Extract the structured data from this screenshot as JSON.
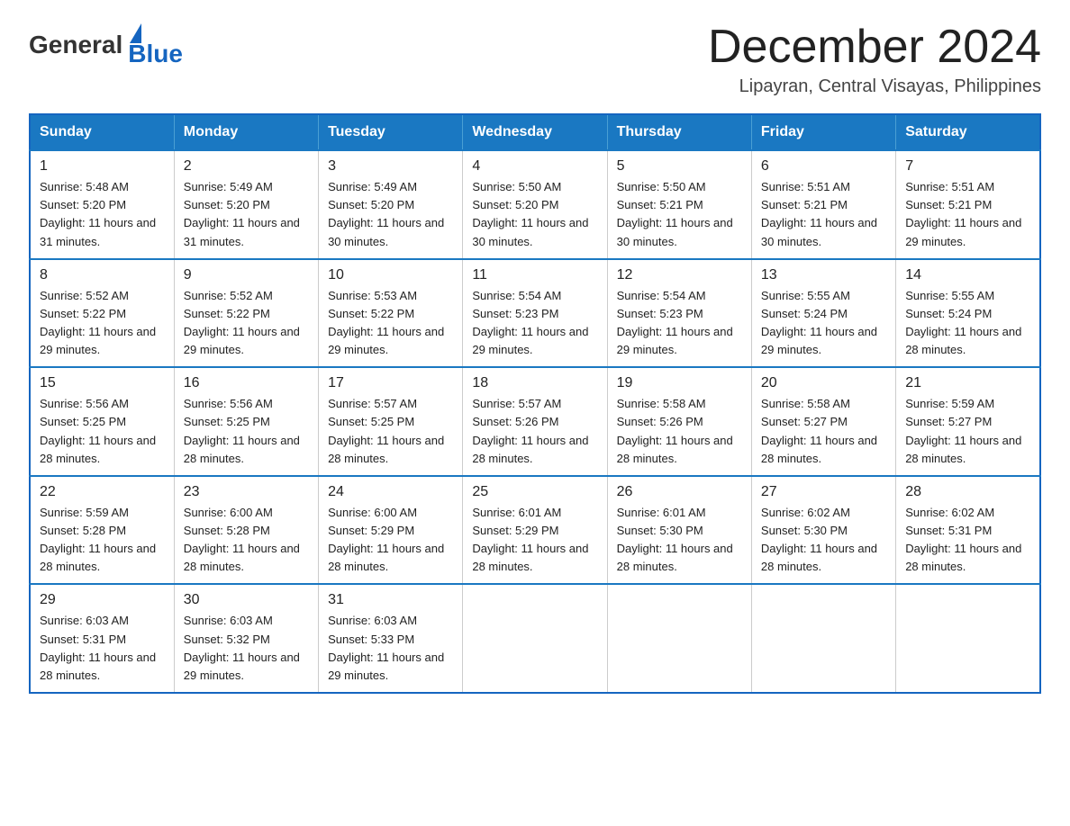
{
  "logo": {
    "general": "General",
    "blue": "Blue"
  },
  "header": {
    "title": "December 2024",
    "subtitle": "Lipayran, Central Visayas, Philippines"
  },
  "days_of_week": [
    "Sunday",
    "Monday",
    "Tuesday",
    "Wednesday",
    "Thursday",
    "Friday",
    "Saturday"
  ],
  "weeks": [
    [
      {
        "day": "1",
        "sunrise": "5:48 AM",
        "sunset": "5:20 PM",
        "daylight": "11 hours and 31 minutes."
      },
      {
        "day": "2",
        "sunrise": "5:49 AM",
        "sunset": "5:20 PM",
        "daylight": "11 hours and 31 minutes."
      },
      {
        "day": "3",
        "sunrise": "5:49 AM",
        "sunset": "5:20 PM",
        "daylight": "11 hours and 30 minutes."
      },
      {
        "day": "4",
        "sunrise": "5:50 AM",
        "sunset": "5:20 PM",
        "daylight": "11 hours and 30 minutes."
      },
      {
        "day": "5",
        "sunrise": "5:50 AM",
        "sunset": "5:21 PM",
        "daylight": "11 hours and 30 minutes."
      },
      {
        "day": "6",
        "sunrise": "5:51 AM",
        "sunset": "5:21 PM",
        "daylight": "11 hours and 30 minutes."
      },
      {
        "day": "7",
        "sunrise": "5:51 AM",
        "sunset": "5:21 PM",
        "daylight": "11 hours and 29 minutes."
      }
    ],
    [
      {
        "day": "8",
        "sunrise": "5:52 AM",
        "sunset": "5:22 PM",
        "daylight": "11 hours and 29 minutes."
      },
      {
        "day": "9",
        "sunrise": "5:52 AM",
        "sunset": "5:22 PM",
        "daylight": "11 hours and 29 minutes."
      },
      {
        "day": "10",
        "sunrise": "5:53 AM",
        "sunset": "5:22 PM",
        "daylight": "11 hours and 29 minutes."
      },
      {
        "day": "11",
        "sunrise": "5:54 AM",
        "sunset": "5:23 PM",
        "daylight": "11 hours and 29 minutes."
      },
      {
        "day": "12",
        "sunrise": "5:54 AM",
        "sunset": "5:23 PM",
        "daylight": "11 hours and 29 minutes."
      },
      {
        "day": "13",
        "sunrise": "5:55 AM",
        "sunset": "5:24 PM",
        "daylight": "11 hours and 29 minutes."
      },
      {
        "day": "14",
        "sunrise": "5:55 AM",
        "sunset": "5:24 PM",
        "daylight": "11 hours and 28 minutes."
      }
    ],
    [
      {
        "day": "15",
        "sunrise": "5:56 AM",
        "sunset": "5:25 PM",
        "daylight": "11 hours and 28 minutes."
      },
      {
        "day": "16",
        "sunrise": "5:56 AM",
        "sunset": "5:25 PM",
        "daylight": "11 hours and 28 minutes."
      },
      {
        "day": "17",
        "sunrise": "5:57 AM",
        "sunset": "5:25 PM",
        "daylight": "11 hours and 28 minutes."
      },
      {
        "day": "18",
        "sunrise": "5:57 AM",
        "sunset": "5:26 PM",
        "daylight": "11 hours and 28 minutes."
      },
      {
        "day": "19",
        "sunrise": "5:58 AM",
        "sunset": "5:26 PM",
        "daylight": "11 hours and 28 minutes."
      },
      {
        "day": "20",
        "sunrise": "5:58 AM",
        "sunset": "5:27 PM",
        "daylight": "11 hours and 28 minutes."
      },
      {
        "day": "21",
        "sunrise": "5:59 AM",
        "sunset": "5:27 PM",
        "daylight": "11 hours and 28 minutes."
      }
    ],
    [
      {
        "day": "22",
        "sunrise": "5:59 AM",
        "sunset": "5:28 PM",
        "daylight": "11 hours and 28 minutes."
      },
      {
        "day": "23",
        "sunrise": "6:00 AM",
        "sunset": "5:28 PM",
        "daylight": "11 hours and 28 minutes."
      },
      {
        "day": "24",
        "sunrise": "6:00 AM",
        "sunset": "5:29 PM",
        "daylight": "11 hours and 28 minutes."
      },
      {
        "day": "25",
        "sunrise": "6:01 AM",
        "sunset": "5:29 PM",
        "daylight": "11 hours and 28 minutes."
      },
      {
        "day": "26",
        "sunrise": "6:01 AM",
        "sunset": "5:30 PM",
        "daylight": "11 hours and 28 minutes."
      },
      {
        "day": "27",
        "sunrise": "6:02 AM",
        "sunset": "5:30 PM",
        "daylight": "11 hours and 28 minutes."
      },
      {
        "day": "28",
        "sunrise": "6:02 AM",
        "sunset": "5:31 PM",
        "daylight": "11 hours and 28 minutes."
      }
    ],
    [
      {
        "day": "29",
        "sunrise": "6:03 AM",
        "sunset": "5:31 PM",
        "daylight": "11 hours and 28 minutes."
      },
      {
        "day": "30",
        "sunrise": "6:03 AM",
        "sunset": "5:32 PM",
        "daylight": "11 hours and 29 minutes."
      },
      {
        "day": "31",
        "sunrise": "6:03 AM",
        "sunset": "5:33 PM",
        "daylight": "11 hours and 29 minutes."
      },
      null,
      null,
      null,
      null
    ]
  ]
}
